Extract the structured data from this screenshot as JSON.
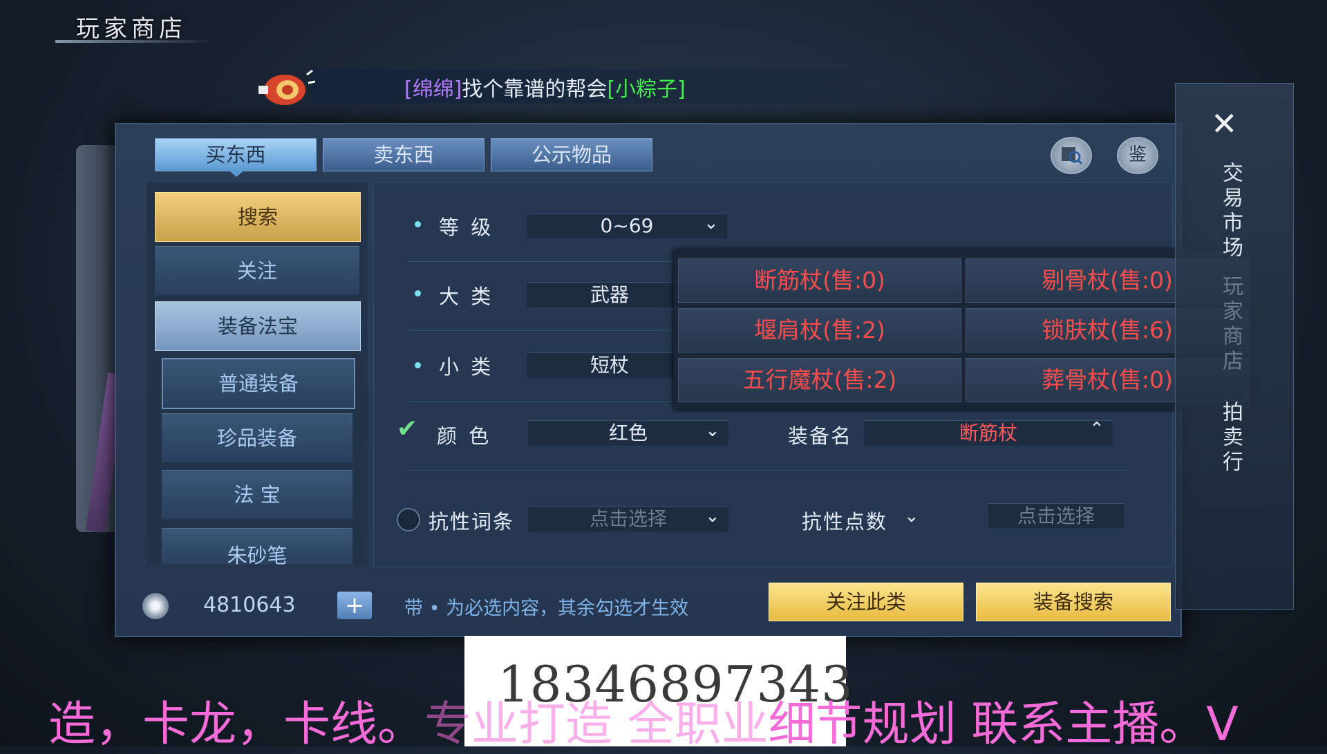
{
  "header": {
    "title": "玩家商店"
  },
  "broadcast": {
    "prefix": "[绵绵]",
    "message": "找个靠谱的帮会",
    "suffix": "[小粽子]",
    "icon": "megaphone-icon"
  },
  "tabs": [
    {
      "label": "买东西",
      "active": true
    },
    {
      "label": "卖东西",
      "active": false
    },
    {
      "label": "公示物品",
      "active": false
    }
  ],
  "top_icons": {
    "magnifier_scroll": "scroll-search-icon",
    "appraise_label": "鉴"
  },
  "sidebar": {
    "items": [
      {
        "label": "搜索",
        "state": "highlight"
      },
      {
        "label": "关注",
        "state": "normal"
      },
      {
        "label": "装备法宝",
        "state": "selected"
      },
      {
        "label": "普通装备",
        "state": "sub-outlined"
      },
      {
        "label": "珍品装备",
        "state": "sub"
      },
      {
        "label": "法 宝",
        "state": "sub"
      },
      {
        "label": "朱砂笔",
        "state": "sub"
      }
    ]
  },
  "form": {
    "level": {
      "label": "等  级",
      "value": "0~69"
    },
    "category": {
      "label": "大  类",
      "value": "武器"
    },
    "subcategory": {
      "label": "小  类",
      "value": "短杖"
    },
    "color": {
      "label": "颜  色",
      "value": "红色",
      "checked": true
    },
    "equip_name": {
      "label": "装备名",
      "value": "断筋杖"
    },
    "resist_entry": {
      "label": "抗性词条",
      "placeholder": "点击选择",
      "checked": false
    },
    "resist_points": {
      "label": "抗性点数",
      "placeholder": "点击选择"
    }
  },
  "dropdown": {
    "items": [
      "断筋杖(售:0)",
      "剔骨杖(售:0)",
      "堰肩杖(售:2)",
      "锁肤杖(售:6)",
      "五行魔杖(售:2)",
      "葬骨杖(售:0)"
    ]
  },
  "side_panel": {
    "close": "✕",
    "label_active": "交易市场",
    "label_dim": "玩家商店",
    "label_bottom": "拍卖行"
  },
  "footer": {
    "money": "4810643",
    "plus": "+",
    "hint": "带 • 为必选内容，其余勾选才生效",
    "follow_button": "关注此类",
    "search_button": "装备搜索"
  },
  "overlay": {
    "phone": "18346897343",
    "ticker_part1": "造，卡龙，卡线。",
    "ticker_part2": "专业打造 全职业",
    "ticker_part3": "细节规划 联系主播。V"
  },
  "colors": {
    "accent_gold": "#e8bb42",
    "item_red": "#ff4c4c",
    "ticker_pink": "#f56bd8",
    "tab_active": "#a9d3f5"
  }
}
